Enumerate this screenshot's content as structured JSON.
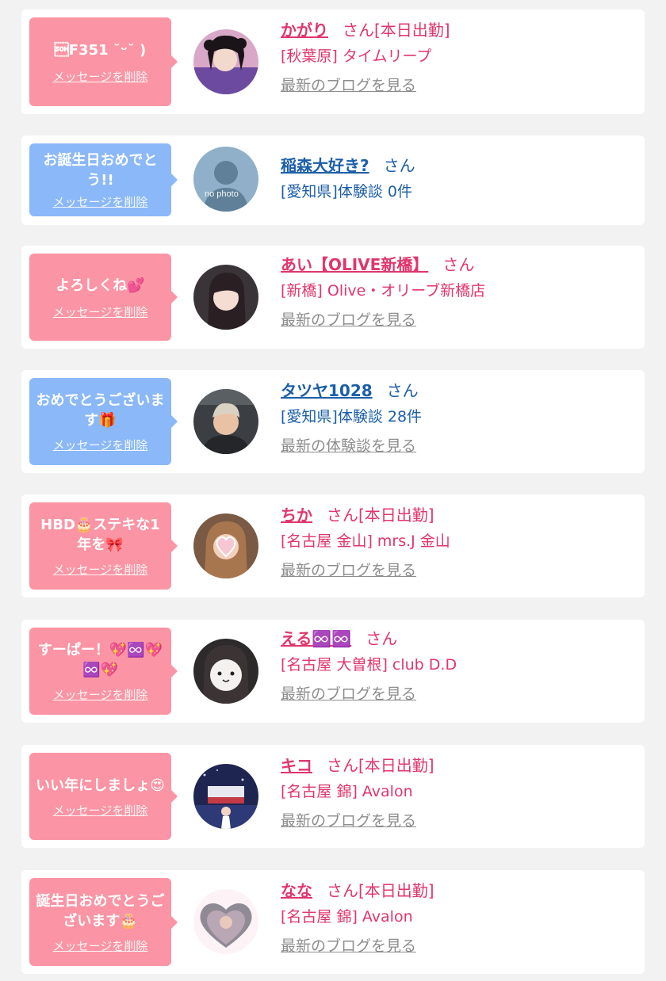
{
  "messages": [
    {
      "bubble_text": "\u0001F351 ˘ᵕ˘ )",
      "bubble_color": "pink",
      "delete_label": "メッセージを削除",
      "avatar_icon": "girl-photo-avatar",
      "name": "かがり",
      "san": "さん",
      "status": "[本日出勤]",
      "sub": "[秋葉原] タイムリープ",
      "more_label": "最新のブログを見る",
      "text_color": "#e0366c"
    },
    {
      "bubble_text": "お誕生日おめでとう!!",
      "bubble_color": "blue",
      "delete_label": "メッセージを削除",
      "avatar_icon": "no-photo-avatar",
      "avatar_caption": "no photo",
      "name": "稲森大好き?",
      "san": "さん",
      "status": "",
      "sub": "[愛知県]体験談 0件",
      "more_label": "",
      "text_color": "#1c5ea8"
    },
    {
      "bubble_text": "よろしくね💕",
      "bubble_color": "pink",
      "delete_label": "メッセージを削除",
      "avatar_icon": "girl-photo-avatar",
      "name": "あい【OLIVE新橋】",
      "san": "さん",
      "status": "",
      "sub": "[新橋] Olive・オリーブ新橋店",
      "more_label": "最新のブログを見る",
      "text_color": "#e0366c"
    },
    {
      "bubble_text": "おめでとうございます🎁",
      "bubble_color": "blue",
      "delete_label": "メッセージを削除",
      "avatar_icon": "man-photo-avatar",
      "name": "タツヤ1028",
      "san": "さん",
      "status": "",
      "sub": "[愛知県]体験談 28件",
      "more_label": "最新の体験談を見る",
      "text_color": "#1c5ea8"
    },
    {
      "bubble_text": "HBD🎂ステキな1年を🎀",
      "bubble_color": "pink",
      "delete_label": "メッセージを削除",
      "avatar_icon": "girl-photo-avatar",
      "name": "ちか",
      "san": "さん",
      "status": "[本日出勤]",
      "sub": "[名古屋 金山] mrs.J 金山",
      "more_label": "最新のブログを見る",
      "text_color": "#e0366c"
    },
    {
      "bubble_text": "すーぱー！💖♾️💖♾️💖",
      "bubble_color": "pink",
      "delete_label": "メッセージを削除",
      "avatar_icon": "girl-photo-avatar",
      "name": "える♾️♾️",
      "san": "さん",
      "status": "",
      "sub": "[名古屋 大曽根] club D.D",
      "more_label": "最新のブログを見る",
      "text_color": "#e0366c"
    },
    {
      "bubble_text": "いい年にしましょ😍",
      "bubble_color": "pink",
      "delete_label": "メッセージを削除",
      "avatar_icon": "girl-photo-avatar",
      "name": "キコ",
      "san": "さん",
      "status": "[本日出勤]",
      "sub": "[名古屋 錦] Avalon",
      "more_label": "最新のブログを見る",
      "text_color": "#e0366c"
    },
    {
      "bubble_text": "誕生日おめでとうございます🎂",
      "bubble_color": "pink",
      "delete_label": "メッセージを削除",
      "avatar_icon": "girl-photo-avatar",
      "name": "なな",
      "san": "さん",
      "status": "[本日出勤]",
      "sub": "[名古屋 錦] Avalon",
      "more_label": "最新のブログを見る",
      "text_color": "#e0366c"
    }
  ]
}
